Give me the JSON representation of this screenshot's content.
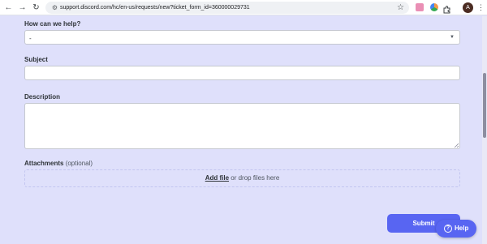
{
  "browser": {
    "url": "support.discord.com/hc/en-us/requests/new?ticket_form_id=360000029731",
    "avatar_letter": "A",
    "back_icon": "←",
    "forward_icon": "→",
    "reload_icon": "↻",
    "site_info_icon": "⚙",
    "star_icon": "☆",
    "menu_icon": "⋮",
    "extension_colors": [
      "#ea8fb5",
      "#f2994a",
      "#34a853"
    ]
  },
  "form": {
    "help_label": "How can we help?",
    "help_select_value": "-",
    "select_caret": "▼",
    "subject_label": "Subject",
    "subject_value": "",
    "description_label": "Description",
    "description_value": "",
    "attachments_label": "Attachments",
    "attachments_optional": "(optional)",
    "add_file": "Add file",
    "drop_text": "or drop files here",
    "submit_label": "Submit"
  },
  "help_widget": {
    "icon": "?",
    "label": "Help"
  },
  "colors": {
    "background": "#dfe0fb",
    "accent": "#5865f2"
  }
}
